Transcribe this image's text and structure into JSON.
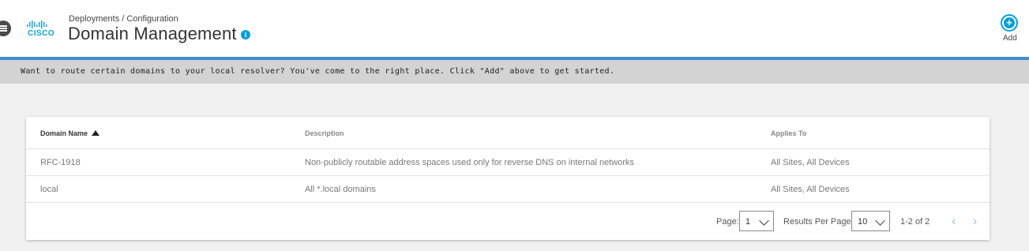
{
  "header": {
    "breadcrumb": "Deployments / Configuration",
    "title": "Domain Management",
    "logo_text": "CISCO",
    "add_label": "Add",
    "menu_icon": "hamburger-menu-icon",
    "info_icon": "info-icon"
  },
  "banner": {
    "text": "Want to route certain domains to your local resolver? You've come to the right place. Click \"Add\" above to get started."
  },
  "table": {
    "columns": [
      {
        "label": "Domain Name",
        "sorted": "ascending"
      },
      {
        "label": "Description"
      },
      {
        "label": "Applies To"
      }
    ],
    "rows": [
      {
        "domain": "RFC-1918",
        "description": "Non-publicly routable address spaces used only for reverse DNS on internal networks",
        "applies_to": "All Sites, All Devices"
      },
      {
        "domain": "local",
        "description": "All *.local domains",
        "applies_to": "All Sites, All Devices"
      }
    ]
  },
  "pagination": {
    "page_label": "Page:",
    "page_value": "1",
    "results_label": "Results Per Page:",
    "results_value": "10",
    "range": "1-2 of 2",
    "prev_icon": "chevron-left-icon",
    "next_icon": "chevron-right-icon"
  },
  "colors": {
    "accent": "#3f8fd2",
    "brand": "#049fd9",
    "banner_bg": "#d3d3d3"
  }
}
